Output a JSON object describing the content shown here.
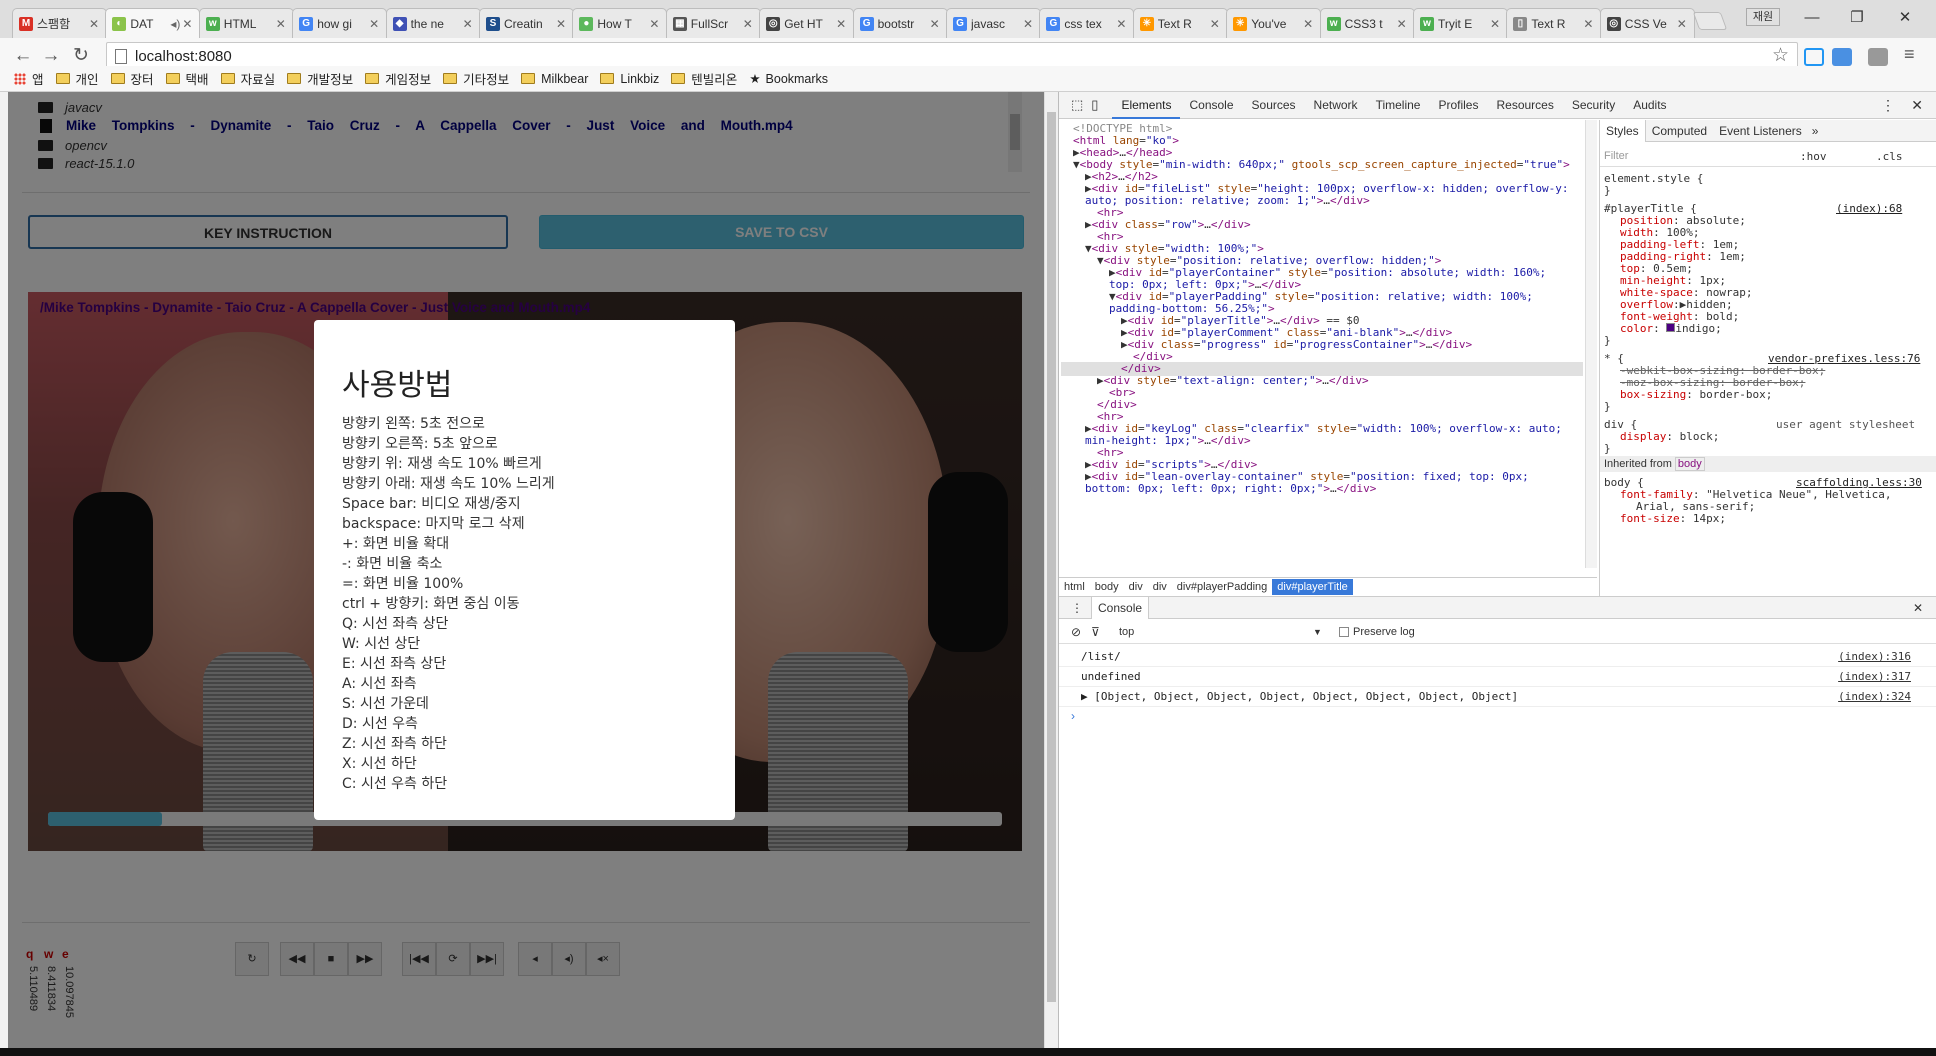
{
  "tabs": [
    {
      "title": "스팸함",
      "fav": "M",
      "color": "#d93025"
    },
    {
      "title": "DAT",
      "fav": "◐",
      "color": "#8bc34a",
      "active": true
    },
    {
      "title": "HTML",
      "fav": "w",
      "color": "#4caf50"
    },
    {
      "title": "how gi",
      "fav": "G",
      "color": "#4285f4"
    },
    {
      "title": "the ne",
      "fav": "◆",
      "color": "#3f51b5"
    },
    {
      "title": "Creatin",
      "fav": "S",
      "color": "#1e4e8c"
    },
    {
      "title": "How T",
      "fav": "●",
      "color": "#5cb85c"
    },
    {
      "title": "FullScr",
      "fav": "▦",
      "color": "#555"
    },
    {
      "title": "Get HT",
      "fav": "◎",
      "color": "#444"
    },
    {
      "title": "bootstr",
      "fav": "G",
      "color": "#4285f4"
    },
    {
      "title": "javasc",
      "fav": "G",
      "color": "#4285f4"
    },
    {
      "title": "css tex",
      "fav": "G",
      "color": "#4285f4"
    },
    {
      "title": "Text R",
      "fav": "✳",
      "color": "#ff9800"
    },
    {
      "title": "You've",
      "fav": "✳",
      "color": "#ff9800"
    },
    {
      "title": "CSS3 t",
      "fav": "w",
      "color": "#4caf50"
    },
    {
      "title": "Tryit E",
      "fav": "w",
      "color": "#4caf50"
    },
    {
      "title": "Text R",
      "fav": "▯",
      "color": "#888"
    },
    {
      "title": "CSS Ve",
      "fav": "◎",
      "color": "#444"
    }
  ],
  "window": {
    "user_label": "재원",
    "minimize": "—",
    "maximize": "❐",
    "close": "✕"
  },
  "url": "localhost:8080",
  "bookmarks": [
    "앱",
    "개인",
    "장터",
    "택배",
    "자료실",
    "개발정보",
    "게임정보",
    "기타정보",
    "Milkbear",
    "Linkbiz",
    "텐빌리온",
    "Bookmarks"
  ],
  "page": {
    "dirs_top": [
      "javacv"
    ],
    "file_row": "Mike Tompkins - Dynamite - Taio Cruz - A Cappella Cover - Just Voice and Mouth.mp4",
    "dirs_bottom": [
      "opencv",
      "react-15.1.0"
    ],
    "key_instruction": "KEY INSTRUCTION",
    "save_csv": "SAVE TO CSV",
    "player_title": "/Mike Tompkins - Dynamite - Taio Cruz - A Cappella Cover - Just Voice and Mouth.mp4",
    "log_keys": [
      "q",
      "w",
      "e"
    ],
    "log_values": [
      "5.110489",
      "8.411834",
      "10.097845"
    ]
  },
  "modal": {
    "title": "사용방법",
    "lines": [
      "방향키 왼쪽: 5초 전으로",
      "방향키 오른쪽: 5초 앞으로",
      "방향키 위: 재생 속도 10% 빠르게",
      "방향키 아래: 재생 속도 10% 느리게",
      "Space bar: 비디오 재생/중지",
      "backspace: 마지막 로그 삭제",
      "+: 화면 비율 확대",
      "-: 화면 비율 축소",
      "=: 화면 비율 100%",
      "ctrl + 방향키: 화면 중심 이동",
      "Q: 시선 좌측 상단",
      "W: 시선 상단",
      "E: 시선 좌측 상단",
      "A: 시선 좌측",
      "S: 시선 가운데",
      "D: 시선 우측",
      "Z: 시선 좌측 하단",
      "X: 시선 하단",
      "C: 시선 우측 하단"
    ]
  },
  "devtools": {
    "tabs": [
      "Elements",
      "Console",
      "Sources",
      "Network",
      "Timeline",
      "Profiles",
      "Resources",
      "Security",
      "Audits"
    ],
    "sidebar_tabs": [
      "Styles",
      "Computed",
      "Event Listeners"
    ],
    "filter_placeholder": "Filter",
    "hov": ":hov",
    "cls": ".cls",
    "breadcrumbs": [
      "html",
      "body",
      "div",
      "div",
      "div#playerPadding",
      "div#playerTitle"
    ],
    "console_label": "Console",
    "console_context": "top",
    "preserve_log": "Preserve log",
    "console_lines": [
      {
        "text": "/list/",
        "loc": "(index):316"
      },
      {
        "text": "undefined",
        "loc": "(index):317"
      },
      {
        "text": "▶ [Object, Object, Object, Object, Object, Object, Object, Object]",
        "loc": "(index):324"
      }
    ]
  }
}
